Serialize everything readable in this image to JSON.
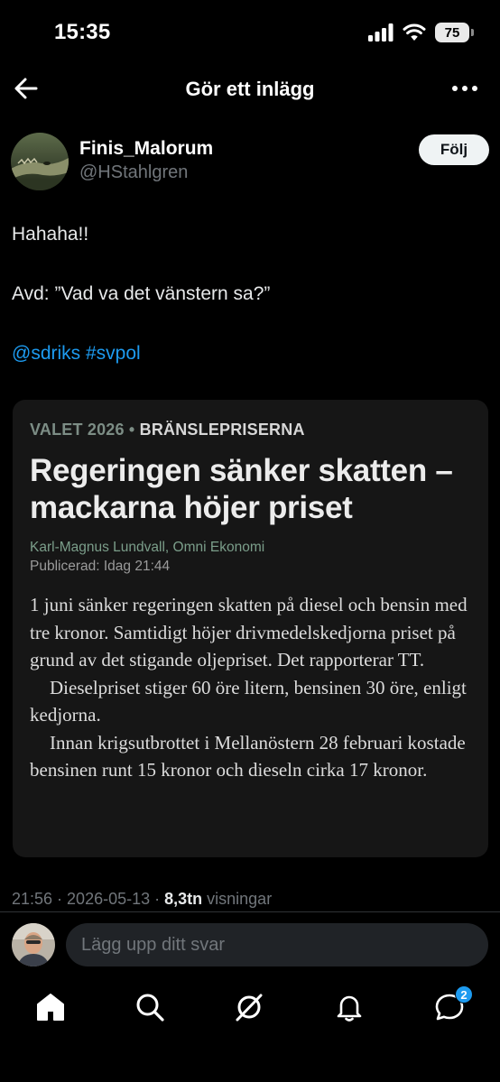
{
  "status_bar": {
    "time": "15:35",
    "battery": "75"
  },
  "header": {
    "title": "Gör ett inlägg"
  },
  "author": {
    "name": "Finis_Malorum",
    "handle": "@HStahlgren",
    "follow_label": "Följ"
  },
  "post": {
    "line1": "Hahaha!!",
    "line2": "Avd: ”Vad va det vänstern sa?”",
    "line3": "@sdriks #svpol"
  },
  "article": {
    "kicker_topic": "VALET 2026",
    "kicker_separator": " • ",
    "kicker_section": "BRÄNSLEPRISERNA",
    "headline": "Regeringen sänker skatten – mackarna höjer priset",
    "byline": "Karl-Magnus Lundvall, Omni Ekonomi",
    "published": "Publicerad: Idag 21:44",
    "paragraphs": [
      "1 juni sänker regeringen skatten på diesel och bensin med tre kronor. Samtidigt höjer drivmedelskedjorna priset på grund av det stigande oljepriset. Det rapporterar TT.",
      "Dieselpriset stiger 60 öre litern, bensinen 30 öre, enligt kedjorna.",
      "Innan krigsutbrottet i Mellanöstern 28 februari kostade bensinen runt 15 kronor och dieseln cirka 17 kronor."
    ]
  },
  "meta": {
    "time": "21:56",
    "dot": " · ",
    "date": "2026-05-13",
    "views": "8,3tn",
    "views_label": "visningar"
  },
  "reply": {
    "placeholder": "Lägg upp ditt svar"
  },
  "tabbar": {
    "items": [
      "home-icon",
      "search-icon",
      "grok-icon",
      "notifications-icon",
      "messages-icon"
    ],
    "messages_badge": "2"
  },
  "colors": {
    "background": "#000000",
    "link": "#1d9bf0",
    "card": "#161616",
    "secondary_text": "#71767b"
  }
}
